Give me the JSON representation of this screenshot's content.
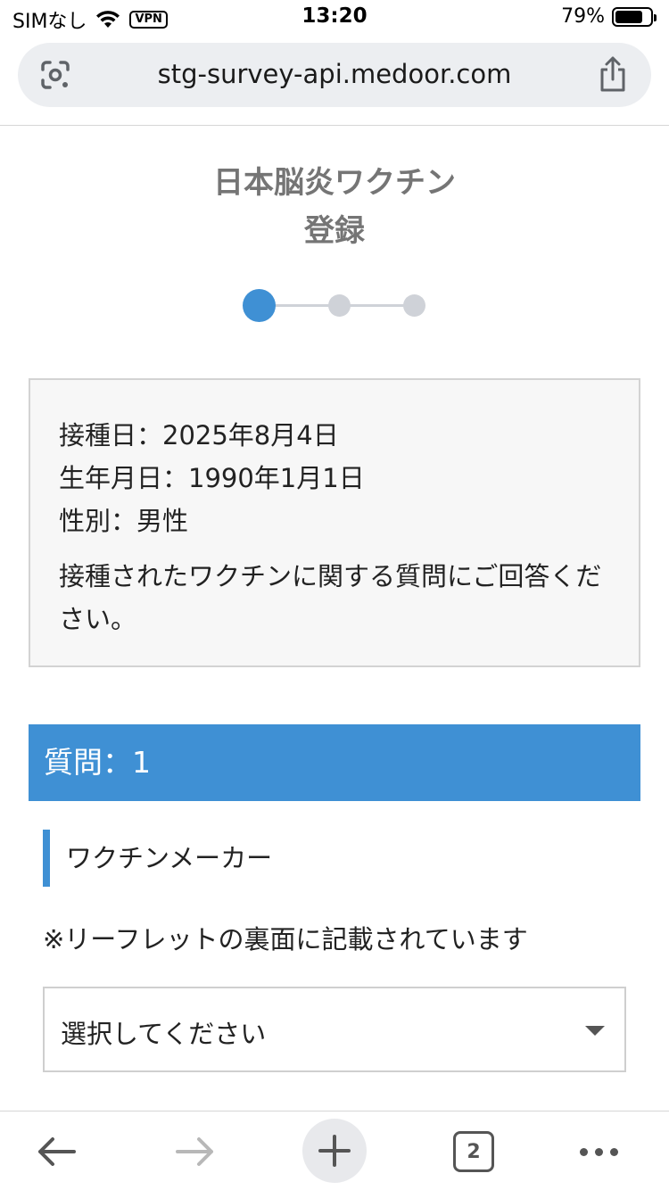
{
  "status_bar": {
    "carrier": "SIMなし",
    "vpn": "VPN",
    "time": "13:20",
    "battery_text": "79%",
    "battery_level": 0.79
  },
  "browser": {
    "url": "stg-survey-api.medoor.com",
    "tab_count": "2"
  },
  "page": {
    "title_line1": "日本脳炎ワクチン",
    "title_line2": "登録",
    "stepper": {
      "total_steps": 3,
      "current_step": 1
    }
  },
  "info": {
    "vaccination_date": "接種日：2025年8月4日",
    "birth_date": "生年月日：1990年1月1日",
    "gender": "性別：男性",
    "instruction": "接種されたワクチンに関する質問にご回答ください。"
  },
  "question": {
    "header": "質問：1",
    "label": "ワクチンメーカー",
    "note": "※リーフレットの裏面に記載されています",
    "select_value": "選択してください"
  },
  "colors": {
    "accent": "#3f90d4",
    "inactive": "#cfd2d8"
  }
}
